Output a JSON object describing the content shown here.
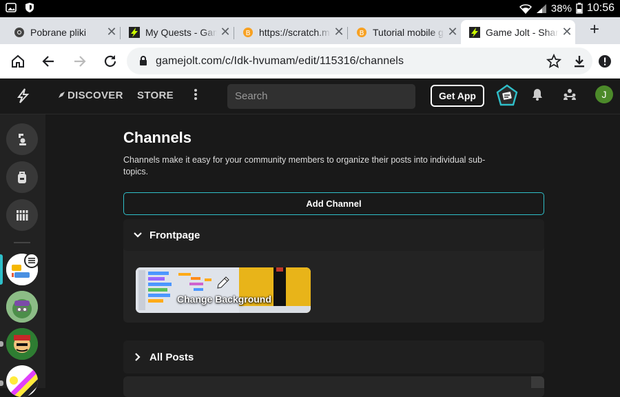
{
  "status_bar": {
    "battery": "38%",
    "time": "10:56"
  },
  "tabs": [
    {
      "title": "Pobrane pliki",
      "favicon": "chrome-icon",
      "active": false
    },
    {
      "title": "My Quests - Game Jolt",
      "favicon": "gamejolt-icon",
      "active": false
    },
    {
      "title": "https://scratch.mit.edu",
      "favicon": "bitcoin-like-icon",
      "active": false
    },
    {
      "title": "Tutorial mobile game",
      "favicon": "bitcoin-like-icon",
      "active": false
    },
    {
      "title": "Game Jolt - Share your",
      "favicon": "gamejolt-icon",
      "active": true
    }
  ],
  "address_bar": {
    "url": "gamejolt.com/c/Idk-hvumam/edit/115316/channels"
  },
  "site_header": {
    "discover_label": "DISCOVER",
    "store_label": "STORE",
    "search_placeholder": "Search",
    "get_app_label": "Get App",
    "user_initial": "J"
  },
  "page": {
    "title": "Channels",
    "description": "Channels make it easy for your community members to organize their posts into individual sub-topics.",
    "add_channel_label": "Add Channel",
    "channels": [
      {
        "name": "Frontpage",
        "expanded": true,
        "change_background_label": "Change Background"
      },
      {
        "name": "All Posts",
        "expanded": false
      }
    ]
  },
  "colors": {
    "accent": "#2fbfc9",
    "background": "#191919",
    "panel": "#232323"
  }
}
